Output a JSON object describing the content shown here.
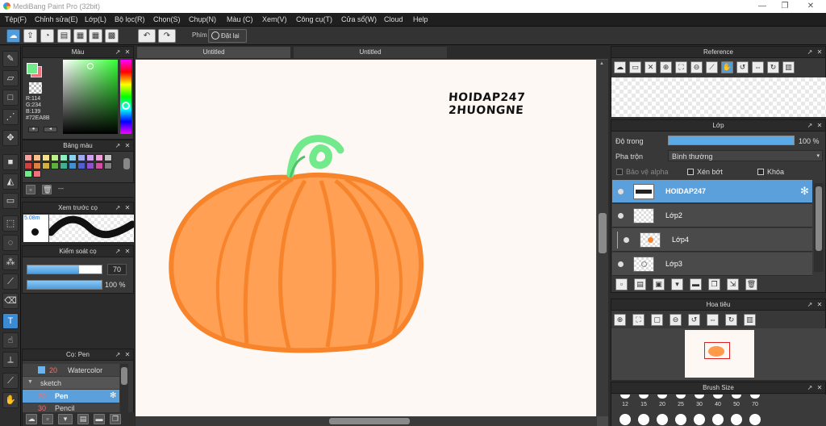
{
  "app": {
    "title": "MediBang Paint Pro (32bit)"
  },
  "menu": [
    "Tệp(F)",
    "Chỉnh sửa(E)",
    "Lớp(L)",
    "Bộ lọc(R)",
    "Chọn(S)",
    "Chụp(N)",
    "Màu (C)",
    "Xem(V)",
    "Công cụ(T)",
    "Cửa sổ(W)",
    "Cloud",
    "Help"
  ],
  "toolbar": {
    "shortcut_label": "Phím",
    "reset_label": "Đặt lại"
  },
  "color_panel": {
    "title": "Màu",
    "r": "R:114",
    "g": "G:234",
    "b": "B:139",
    "hex": "#72EA8B",
    "main_color": "#72EA8B",
    "sub_color": "#F0727E"
  },
  "palette_panel": {
    "title": "Bảng màu",
    "footer": "---"
  },
  "brush_preview_panel": {
    "title": "Xem trước cọ",
    "size": "5.08m"
  },
  "brush_control_panel": {
    "title": "Kiểm soát cọ",
    "size_value": "70",
    "opacity_value": "100 %",
    "size_fraction": 0.7,
    "opacity_fraction": 1.0
  },
  "brush_panel": {
    "title": "Cọ: Pen",
    "items": [
      {
        "size": "20",
        "name": "Watercolor"
      },
      {
        "size": "",
        "name": "sketch"
      },
      {
        "size": "70",
        "name": "Pen"
      },
      {
        "size": "30",
        "name": "Pencil"
      }
    ]
  },
  "document": {
    "tabs": [
      "Untitled",
      "Untitled"
    ],
    "signature": {
      "line1": "HOIDAP247",
      "line2": "2HUONGNE"
    }
  },
  "reference_panel": {
    "title": "Reference"
  },
  "layer_panel": {
    "title": "Lớp",
    "opacity_label": "Độ trong",
    "opacity_value": "100 %",
    "opacity_fraction": 1.0,
    "blend_label": "Pha trộn",
    "blend_value": "Bình thường",
    "protect_alpha": "Bảo vệ alpha",
    "clipping": "Xén bớt",
    "lock": "Khóa",
    "layers": [
      {
        "name": "HOIDAP247",
        "selected": true
      },
      {
        "name": "Lớp2",
        "selected": false
      },
      {
        "name": "Lớp4",
        "selected": false
      },
      {
        "name": "Lớp3",
        "selected": false
      }
    ]
  },
  "navigator_panel": {
    "title": "Hoa tiêu"
  },
  "brush_size_panel": {
    "title": "Brush Size",
    "sizes": [
      "12",
      "15",
      "20",
      "25",
      "30",
      "40",
      "50",
      "70"
    ]
  },
  "colors": {
    "pumpkin": "#FF9A4A",
    "pumpkin_stroke": "#F7842A",
    "stem": "#72EA8B",
    "accent": "#5BA0DB"
  }
}
